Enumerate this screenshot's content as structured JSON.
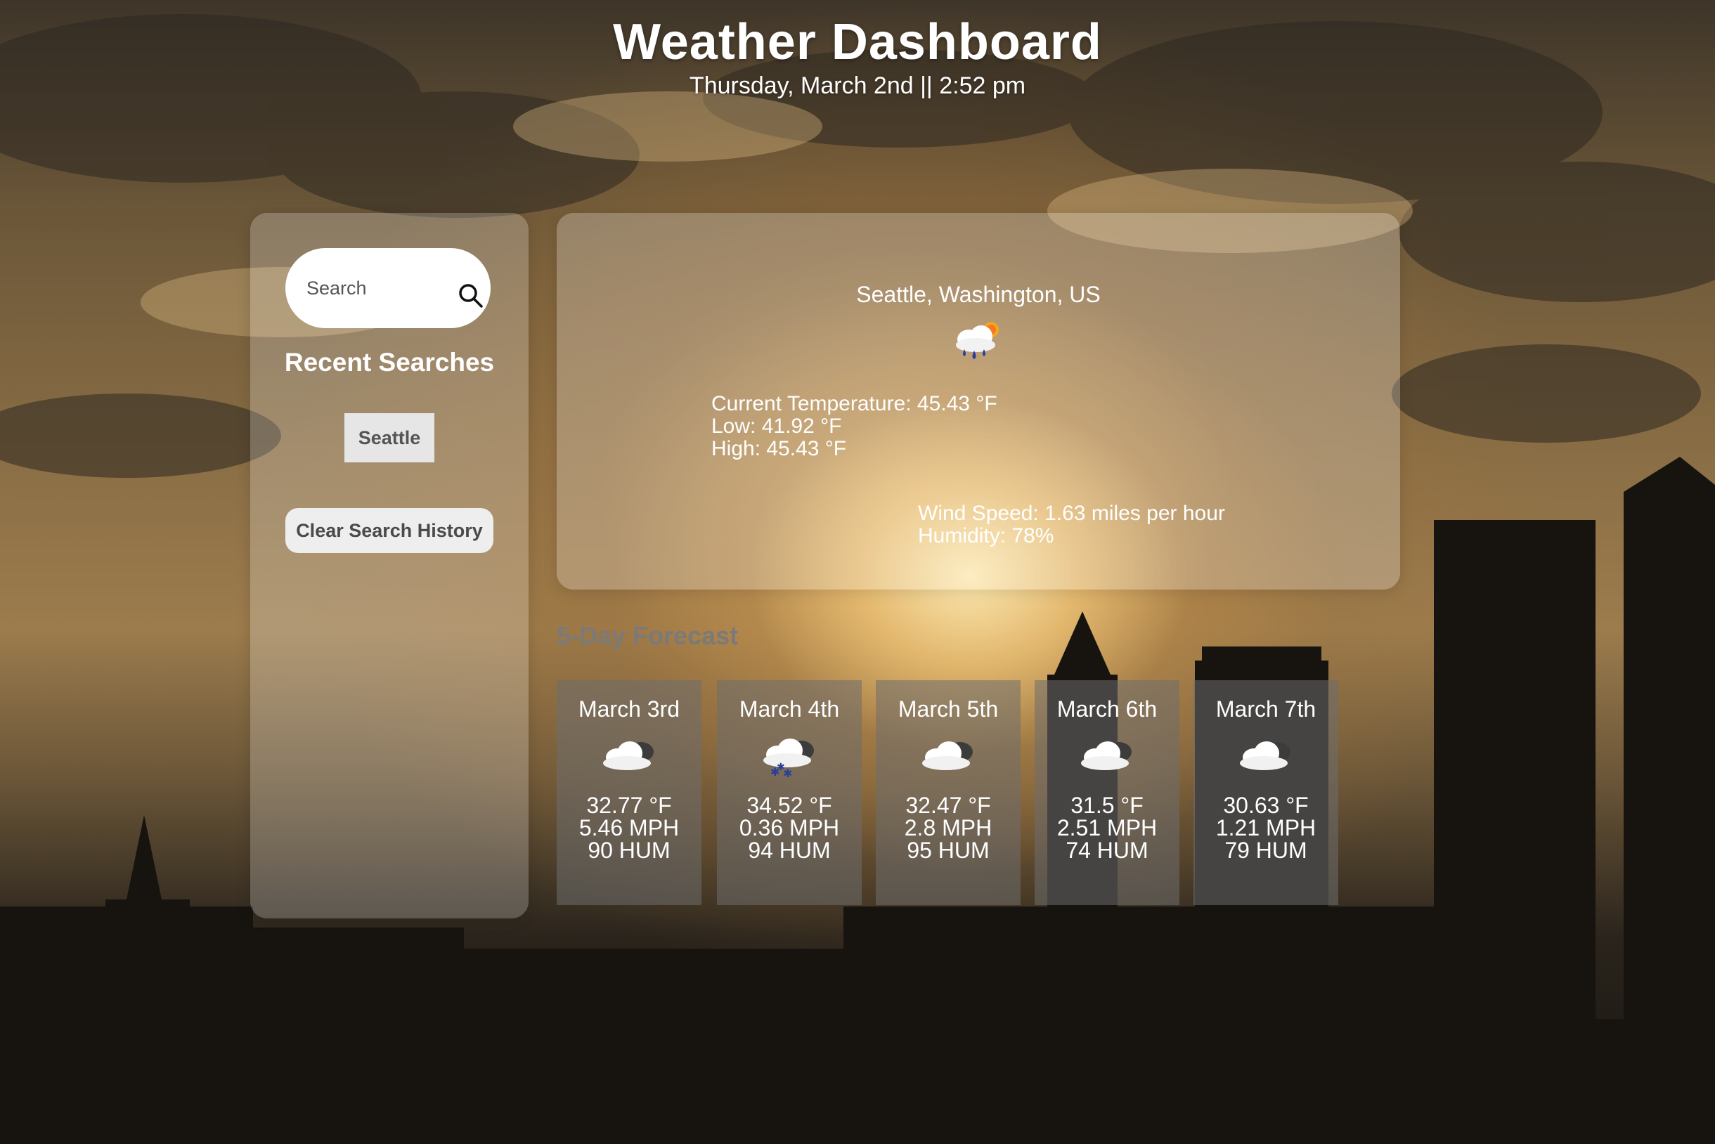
{
  "header": {
    "title": "Weather Dashboard",
    "datetime": "Thursday, March 2nd || 2:52 pm"
  },
  "sidebar": {
    "search_placeholder": "Search",
    "search_icon": "search-icon",
    "recent_title": "Recent Searches",
    "recent_items": [
      "Seattle"
    ],
    "clear_label": "Clear Search History"
  },
  "current": {
    "location": "Seattle, Washington, US",
    "icon": "rain-sun-icon",
    "temperature": "Current Temperature: 45.43 °F",
    "low": "Low: 41.92 °F",
    "high": "High: 45.43 °F",
    "wind": "Wind Speed: 1.63 miles per hour",
    "humidity": "Humidity: 78%"
  },
  "forecast": {
    "title": "5-Day Forecast",
    "days": [
      {
        "date": "March 3rd",
        "icon": "cloud-icon",
        "temp": "32.77 °F",
        "wind": "5.46 MPH",
        "hum": "90 HUM"
      },
      {
        "date": "March 4th",
        "icon": "snow-cloud-icon",
        "temp": "34.52 °F",
        "wind": "0.36 MPH",
        "hum": "94 HUM"
      },
      {
        "date": "March 5th",
        "icon": "cloud-icon",
        "temp": "32.47 °F",
        "wind": "2.8 MPH",
        "hum": "95 HUM"
      },
      {
        "date": "March 6th",
        "icon": "cloud-icon",
        "temp": "31.5 °F",
        "wind": "2.51 MPH",
        "hum": "74 HUM"
      },
      {
        "date": "March 7th",
        "icon": "cloud-icon",
        "temp": "30.63 °F",
        "wind": "1.21 MPH",
        "hum": "79 HUM"
      }
    ]
  },
  "colors": {
    "panel": "#ffffff",
    "forecast_title": "#7a7a7a",
    "card": "#6e6e6e"
  }
}
